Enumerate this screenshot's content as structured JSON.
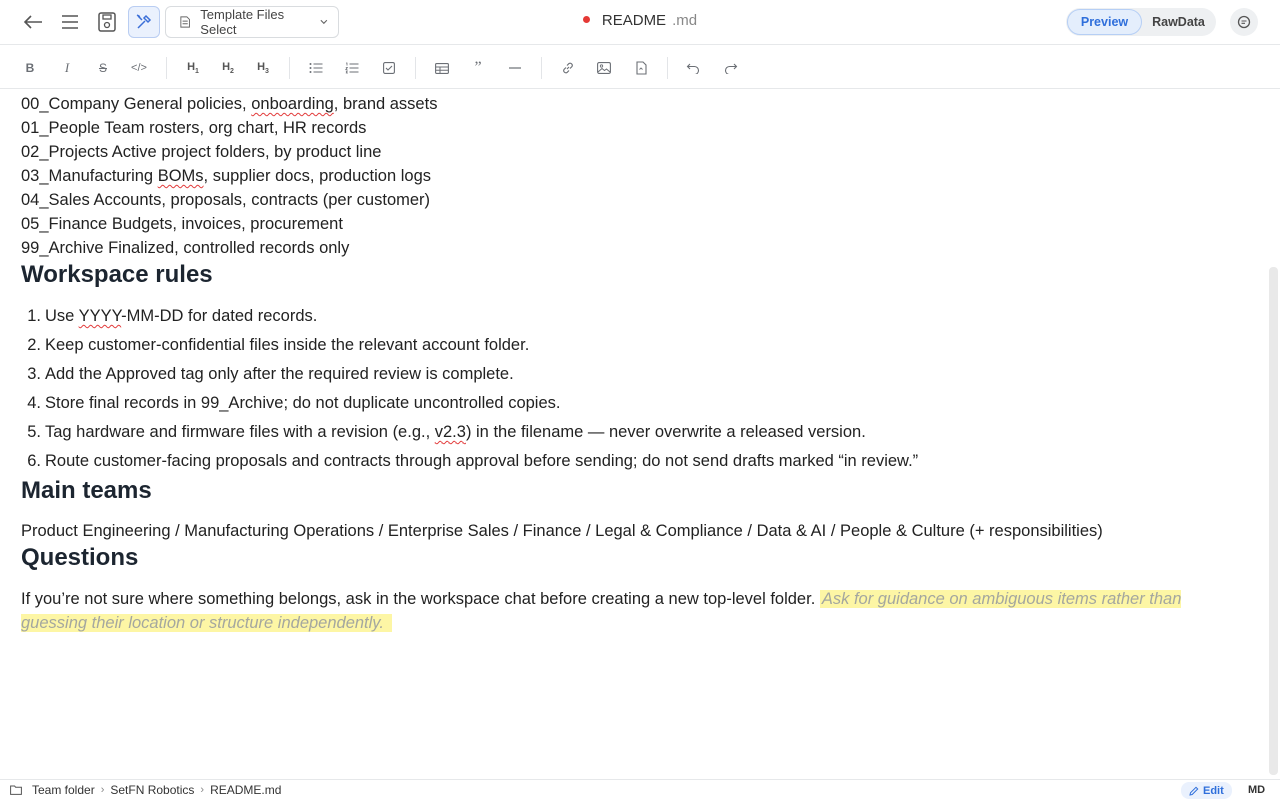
{
  "topbar": {
    "template_label": "Template Files Select",
    "doc_name": "README",
    "doc_ext": ".md",
    "modes": [
      "Preview",
      "RawData"
    ],
    "active_mode": "Preview",
    "unsaved_dot_color": "#e53935"
  },
  "toolbar": {
    "items": [
      "bold-icon",
      "italic-icon",
      "strikethrough-icon",
      "code-icon",
      "heading-1",
      "heading-2",
      "heading-3",
      "bullet-list-icon",
      "ordered-list-icon",
      "task-list-icon",
      "table-icon",
      "quote-icon",
      "horizontal-rule-icon",
      "link-icon",
      "image-icon",
      "file-icon",
      "undo-icon",
      "redo-icon"
    ],
    "h1": "H",
    "h2": "H",
    "h3": "H"
  },
  "content": {
    "directories": [
      {
        "pre": "00_Company General policies, ",
        "wavy": "onboarding",
        "post": ", brand assets"
      },
      {
        "pre": "01_People Team rosters, org chart, HR records",
        "wavy": "",
        "post": ""
      },
      {
        "pre": "02_Projects Active project folders, by product line",
        "wavy": "",
        "post": ""
      },
      {
        "pre": "03_Manufacturing ",
        "wavy": "BOMs",
        "post": ", supplier docs, production logs"
      },
      {
        "pre": "04_Sales Accounts, proposals, contracts (per customer)",
        "wavy": "",
        "post": ""
      },
      {
        "pre": "05_Finance Budgets, invoices, procurement",
        "wavy": "",
        "post": ""
      },
      {
        "pre": "99_Archive Finalized, controlled records only",
        "wavy": "",
        "post": ""
      }
    ],
    "workspace_rules_heading": "Workspace rules",
    "rules": [
      {
        "num": "1.",
        "pre": "Use ",
        "wavy": "YYYY",
        "post": "-MM-DD for dated records."
      },
      {
        "num": "2.",
        "pre": "Keep customer-confidential files inside the relevant account folder.",
        "wavy": "",
        "post": ""
      },
      {
        "num": "3.",
        "pre": "Add the Approved tag only after the required review is complete.",
        "wavy": "",
        "post": ""
      },
      {
        "num": "4.",
        "pre": "Store final records in 99_Archive; do not duplicate uncontrolled copies.",
        "wavy": "",
        "post": ""
      },
      {
        "num": "5.",
        "pre": "Tag hardware and firmware files with a revision (e.g., ",
        "wavy": "v2.3",
        "post": ") in the filename — never overwrite a released version."
      },
      {
        "num": "6.",
        "pre": "Route customer-facing proposals and contracts through approval before sending; do not send drafts marked “in review.”",
        "wavy": "",
        "post": ""
      }
    ],
    "main_teams_heading": "Main teams",
    "teams_text": "Product Engineering / Manufacturing Operations / Enterprise Sales / Finance / Legal & Compliance / Data & AI / People & Culture (+ responsibilities)",
    "questions_heading": "Questions",
    "questions_text": "If you’re not sure where something belongs, ask in the workspace chat before creating a new top-level folder.",
    "questions_highlight": "Ask for guidance on ambiguous items rather than guessing their location or structure independently."
  },
  "statusbar": {
    "crumbs": [
      "Team folder",
      "SetFN Robotics",
      "README.md"
    ],
    "edit_label": "Edit",
    "format_label": "MD"
  }
}
